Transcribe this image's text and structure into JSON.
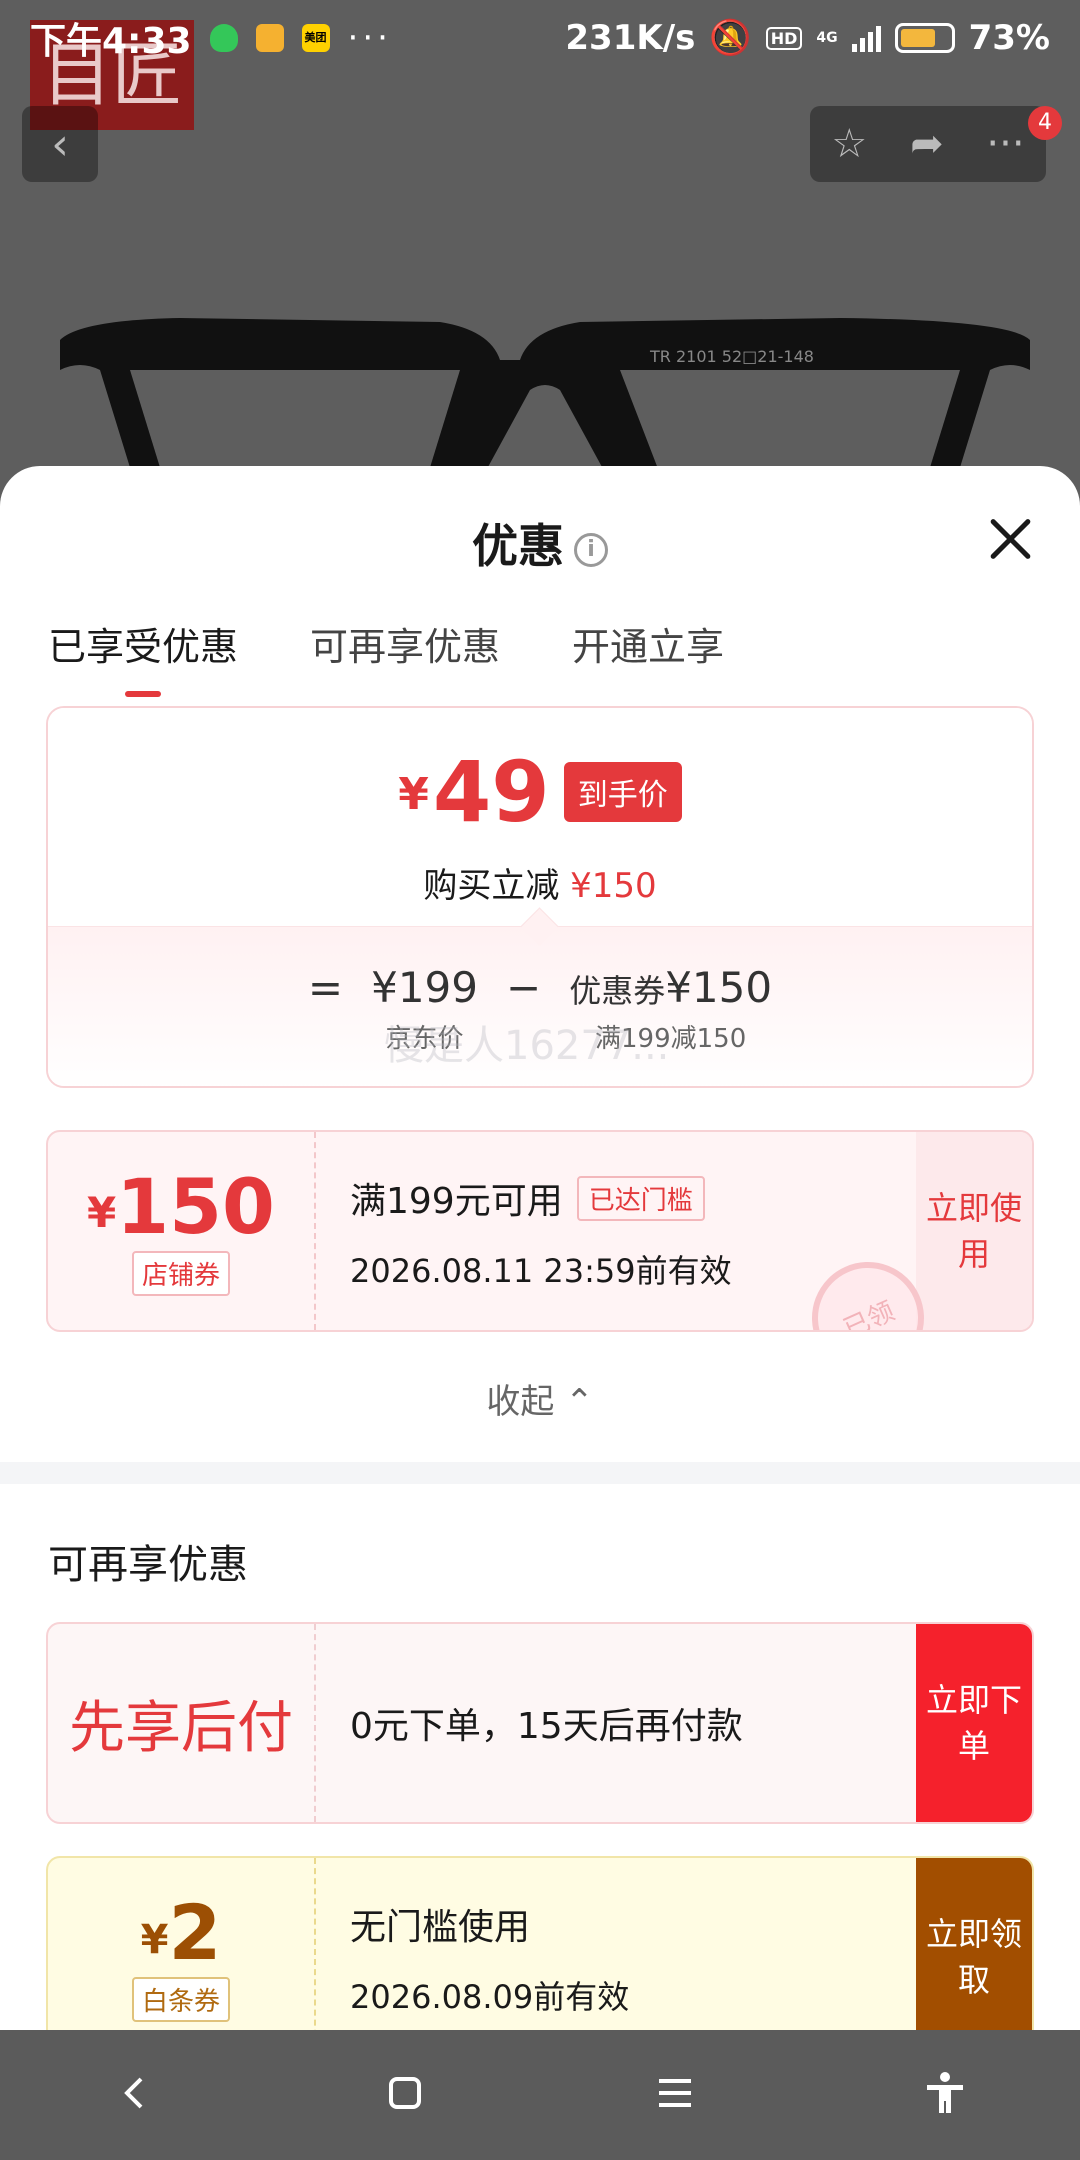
{
  "status_bar": {
    "time": "下午4:33",
    "meituan_label": "美团",
    "more_dots": "···",
    "net_speed": "231K/s",
    "hd_label": "HD",
    "network_label": "4G",
    "battery_percent": "73%",
    "battery_level": 0.73
  },
  "background": {
    "logo_text": "目匠",
    "cart_badge_count": "4",
    "glasses_model_text": "TR 2101 52□21-148"
  },
  "sheet": {
    "title": "优惠",
    "tabs": [
      {
        "label": "已享受优惠",
        "active": true
      },
      {
        "label": "可再享优惠",
        "active": false
      },
      {
        "label": "开通立享",
        "active": false
      }
    ],
    "summary": {
      "currency": "¥",
      "final_price": "49",
      "final_price_tag": "到手价",
      "save_label": "购买立减",
      "save_amount": "¥150",
      "equals": "=",
      "minus": "−",
      "jd_price": "¥199",
      "jd_price_label": "京东价",
      "coupon_label": "优惠券",
      "coupon_value": "¥150",
      "coupon_rule": "满199减150",
      "watermark": "慢是人16277..."
    },
    "store_coupon": {
      "currency": "¥",
      "amount": "150",
      "type": "店铺券",
      "condition": "满199元可用",
      "status_chip": "已达门槛",
      "valid_until": "2026.08.11 23:59前有效",
      "action": "立即使用",
      "stamp": "已领"
    },
    "collapse_label": "收起",
    "more_section_title": "可再享优惠",
    "pay_later": {
      "label": "先享后付",
      "desc": "0元下单，15天后再付款",
      "action": "立即下单"
    },
    "baitiao_coupon": {
      "currency": "¥",
      "amount": "2",
      "type": "白条券",
      "title": "无门槛使用",
      "valid_until": "2026.08.09前有效",
      "action": "立即领取"
    }
  },
  "colors": {
    "accent_red": "#e4393c",
    "cta_red": "#f5212c",
    "cta_brown": "#a24e00"
  }
}
